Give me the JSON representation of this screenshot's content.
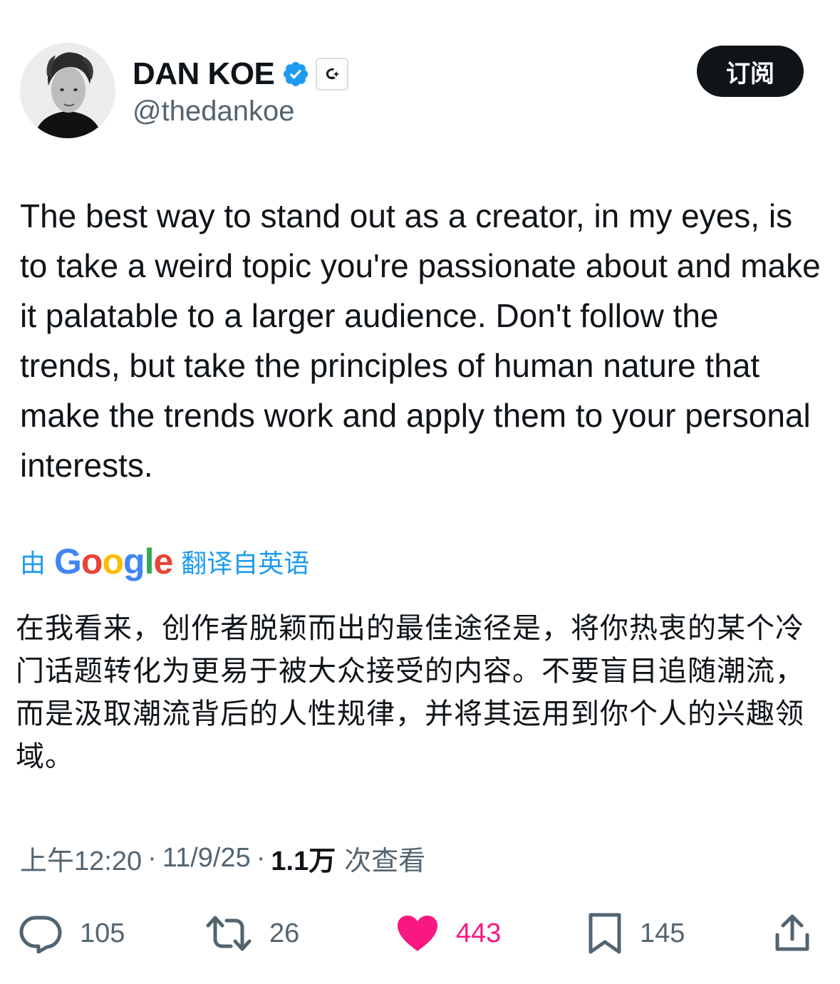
{
  "author": {
    "display_name": "DAN KOE",
    "handle": "@thedankoe",
    "verified_icon": "verified-badge-icon",
    "verified_color": "#1d9bf0",
    "affiliation_icon": "affiliate-logo-icon"
  },
  "header": {
    "subscribe_label": "订阅"
  },
  "tweet": {
    "text": "The best way to stand out as a creator, in my eyes, is to take a weird topic you're passionate about and make it palatable to a larger audience. Don't follow the trends, but take the principles of human nature that make the trends work and apply them to your personal interests."
  },
  "translation": {
    "prefix": "由",
    "provider": "Google",
    "suffix": "翻译自英语",
    "text": "在我看来，创作者脱颖而出的最佳途径是，将你热衷的某个冷门话题转化为更易于被大众接受的内容。不要盲目追随潮流，而是汲取潮流背后的人性规律，并将其运用到你个人的兴趣领域。",
    "link_color": "#1d9bf0"
  },
  "meta": {
    "time": "上午12:20",
    "date": "11/9/25",
    "views_count": "1.1万",
    "views_label": "次查看",
    "separator": "·"
  },
  "actions": {
    "reply_count": "105",
    "repost_count": "26",
    "like_count": "443",
    "bookmark_count": "145",
    "like_color": "#f91880",
    "icon_color": "#536471"
  }
}
